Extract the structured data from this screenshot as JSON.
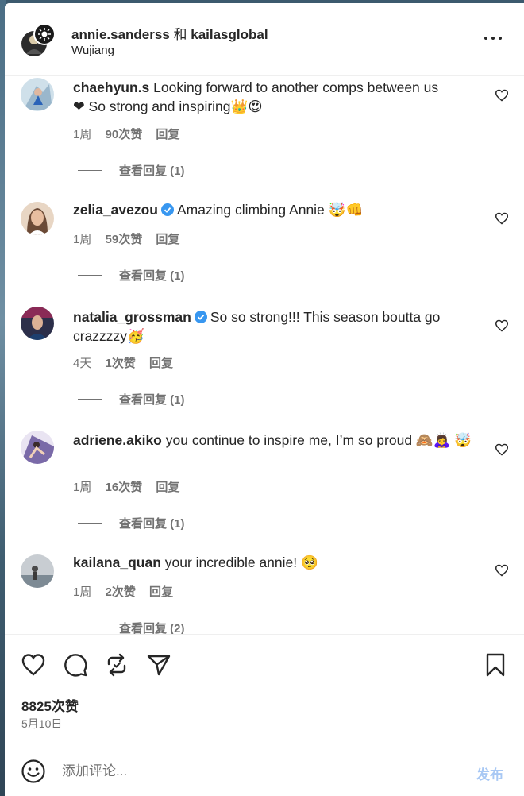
{
  "header": {
    "user1": "annie.sanderss",
    "joiner": "和",
    "user2": "kailasglobal",
    "location": "Wujiang"
  },
  "comments": [
    {
      "username": "chaehyun.s",
      "verified": false,
      "text": "Looking forward to another comps between us",
      "text_line2": "❤ So strong and inspiring👑😍",
      "time": "1周",
      "likes": "90次赞",
      "reply": "回复",
      "view_replies": "查看回复 (1)"
    },
    {
      "username": "zelia_avezou",
      "verified": true,
      "text": "Amazing climbing Annie 🤯👊",
      "time": "1周",
      "likes": "59次赞",
      "reply": "回复",
      "view_replies": "查看回复 (1)"
    },
    {
      "username": "natalia_grossman",
      "verified": true,
      "text": "So so strong!!! This season boutta go crazzzzy🥳",
      "time": "4天",
      "likes": "1次赞",
      "reply": "回复",
      "view_replies": "查看回复 (1)"
    },
    {
      "username": "adriene.akiko",
      "verified": false,
      "text": "you continue to inspire me, I’m so proud 🙈🙇‍♀️ 🤯",
      "time": "1周",
      "likes": "16次赞",
      "reply": "回复",
      "view_replies": "查看回复 (1)"
    },
    {
      "username": "kailana_quan",
      "verified": false,
      "text": "your incredible annie! 🥺",
      "time": "1周",
      "likes": "2次赞",
      "reply": "回复",
      "view_replies": "查看回复 (2)"
    }
  ],
  "actions": {
    "like_icon": "heart-icon",
    "comment_icon": "comment-bubble-icon",
    "share_icon": "repost-icon",
    "send_icon": "paper-plane-icon",
    "save_icon": "bookmark-icon",
    "likes_total": "8825次赞",
    "date": "5月10日"
  },
  "composer": {
    "placeholder": "添加评论...",
    "post_label": "发布",
    "emoji_icon": "smiley-icon"
  },
  "colors": {
    "text": "#262626",
    "muted": "#737373",
    "verified": "#3897f0",
    "post_disabled": "#a8c8f4"
  }
}
